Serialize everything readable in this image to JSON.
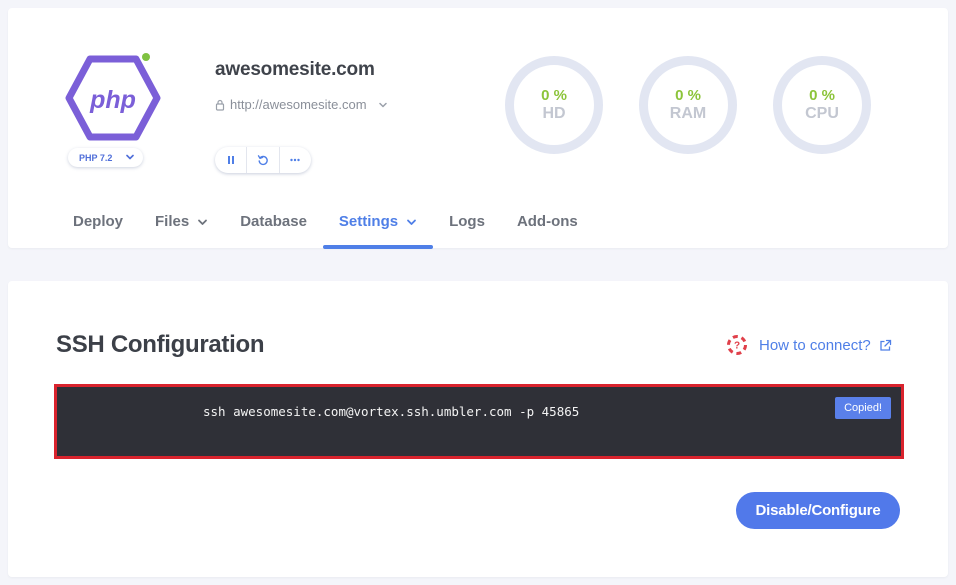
{
  "site": {
    "name": "awesomesite.com",
    "url": "http://awesomesite.com",
    "php_version": "PHP 7.2",
    "logo_text": "php"
  },
  "gauges": [
    {
      "label": "HD",
      "value": "0 %"
    },
    {
      "label": "RAM",
      "value": "0 %"
    },
    {
      "label": "CPU",
      "value": "0 %"
    }
  ],
  "tabs": [
    {
      "label": "Deploy"
    },
    {
      "label": "Files"
    },
    {
      "label": "Database"
    },
    {
      "label": "Settings"
    },
    {
      "label": "Logs"
    },
    {
      "label": "Add-ons"
    }
  ],
  "ssh": {
    "title": "SSH Configuration",
    "how_to_connect": "How to connect?",
    "command": "ssh awesomesite.com@vortex.ssh.umbler.com -p 45865",
    "copied_badge": "Copied!",
    "action_button": "Disable/Configure"
  },
  "icons": {
    "logo": "php-hexagon-icon",
    "status": "status-online-dot",
    "lock": "lock-icon",
    "pause": "pause-icon",
    "restart": "restart-icon",
    "more": "more-icon",
    "help": "lifebuoy-icon",
    "external": "external-link-icon"
  },
  "colors": {
    "accent": "#4f7fe7",
    "gauge_value": "#8cc43a",
    "logo": "#7b5fd8",
    "terminal_bg": "#2f3037",
    "highlight_border": "#d9232d",
    "status_online": "#7fc241"
  }
}
